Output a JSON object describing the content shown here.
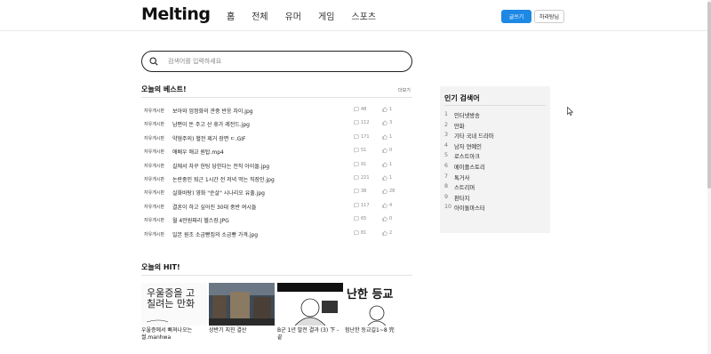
{
  "header": {
    "logo": "Melting",
    "nav": [
      "홈",
      "전체",
      "유머",
      "게임",
      "스포츠"
    ],
    "write_label": "글쓰기",
    "user_label": "하라탕님"
  },
  "search": {
    "placeholder": "검색어를 입력하세요"
  },
  "best": {
    "title": "오늘의 베스트!",
    "more": "더보기",
    "rows": [
      {
        "category": "자유게시판",
        "title": "보아와 엄정화의 관중 반응 차이.jpg",
        "comments": "48",
        "likes": "1"
      },
      {
        "category": "자유게시판",
        "title": "남편이 돈 주고 산 휴가 레전드.jpg",
        "comments": "112",
        "likes": "3"
      },
      {
        "category": "자유게시판",
        "title": "약혐주의) 혈전 제거 장면 ㄷ.GIF",
        "comments": "171",
        "likes": "1"
      },
      {
        "category": "자유게시판",
        "title": "애배우 애교 원탑.mp4",
        "comments": "51",
        "likes": "0"
      },
      {
        "category": "자유게시판",
        "title": "길에서 자꾸 헌팅 당한다는 전직 아이돌.jpg",
        "comments": "91",
        "likes": "1"
      },
      {
        "category": "자유게시판",
        "title": "논란중인 퇴근 1시간 전 저녁 먹는 직장인.jpg",
        "comments": "221",
        "likes": "1"
      },
      {
        "category": "자유게시판",
        "title": "실화바탕) 영화 \"순살\" 시나리오 유출.jpg",
        "comments": "38",
        "likes": "28"
      },
      {
        "category": "자유게시판",
        "title": "결혼이 하고 싶어진 30대 중반 여시들",
        "comments": "117",
        "likes": "4"
      },
      {
        "category": "자유게시판",
        "title": "월 4만원짜리 헬스장.JPG",
        "comments": "65",
        "likes": "0"
      },
      {
        "category": "자유게시판",
        "title": "일본 원조 소금빵집의 소금빵 가격.jpg",
        "comments": "81",
        "likes": "2"
      }
    ]
  },
  "popular": {
    "title": "인기 검색어",
    "items": [
      {
        "rank": "1",
        "term": "인터넷방송"
      },
      {
        "rank": "2",
        "term": "만화"
      },
      {
        "rank": "3",
        "term": "기타 국내 드라마"
      },
      {
        "rank": "4",
        "term": "남자 연예인"
      },
      {
        "rank": "5",
        "term": "로스트아크"
      },
      {
        "rank": "6",
        "term": "메이플스토리"
      },
      {
        "rank": "7",
        "term": "톡거사"
      },
      {
        "rank": "8",
        "term": "스트리머"
      },
      {
        "rank": "9",
        "term": "판타지"
      },
      {
        "rank": "10",
        "term": "아이돌마스터"
      }
    ]
  },
  "hit": {
    "title": "오늘의 HIT!",
    "cards": [
      {
        "caption": "우울증에서 빠져나오는 썰.manhwa",
        "thumb_text": "우울증을 고칠려는 만화"
      },
      {
        "caption": "상반기 지진 결산",
        "thumb_text": ""
      },
      {
        "caption": "B군 1년 발전 결과 (3) 下 - 끝",
        "thumb_text": ""
      },
      {
        "caption": "험난한 등교길1~8 完",
        "thumb_text": "난한 등교"
      }
    ]
  },
  "colors": {
    "accent": "#1e88e5",
    "sidebar_bg": "#f3f3f3"
  }
}
